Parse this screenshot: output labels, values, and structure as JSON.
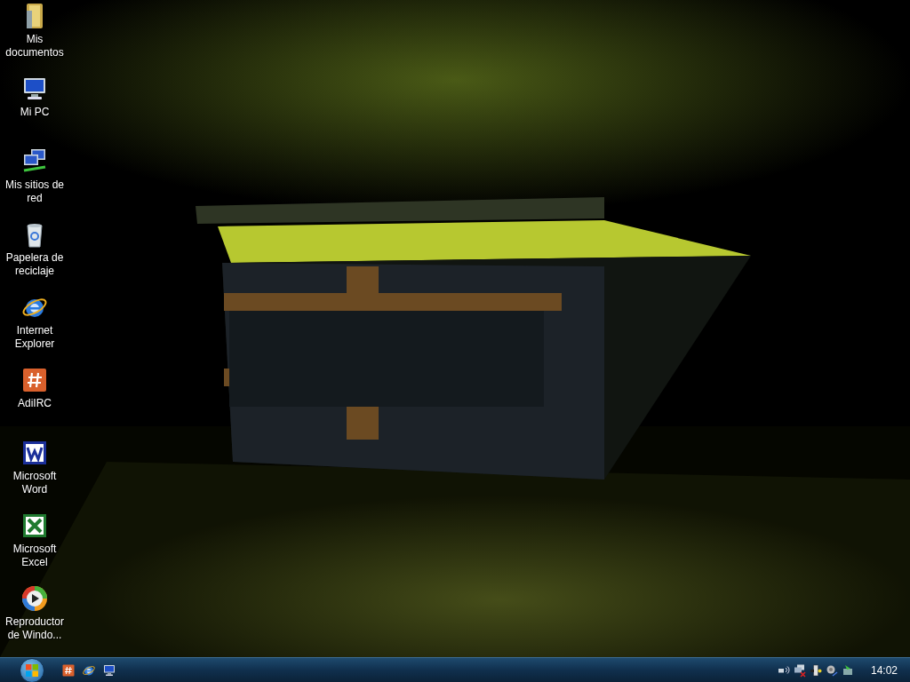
{
  "desktop": {
    "icons": [
      {
        "label": "Mis documentos",
        "kind": "folder"
      },
      {
        "label": "Mi PC",
        "kind": "computer"
      },
      {
        "label": "Mis sitios de red",
        "kind": "network"
      },
      {
        "label": "Papelera de reciclaje",
        "kind": "recycle"
      },
      {
        "label": "Internet Explorer",
        "kind": "browser"
      },
      {
        "label": "AdiIRC",
        "kind": "chat"
      },
      {
        "label": "Microsoft Word",
        "kind": "word"
      },
      {
        "label": "Microsoft Excel",
        "kind": "excel"
      },
      {
        "label": "Reproductor de Windo...",
        "kind": "player"
      }
    ]
  },
  "taskbar": {
    "quick_launch": [
      {
        "kind": "chat"
      },
      {
        "kind": "browser"
      },
      {
        "kind": "desktop"
      }
    ],
    "tray": [
      {
        "kind": "wireless"
      },
      {
        "kind": "network-error"
      },
      {
        "kind": "usb"
      },
      {
        "kind": "volume"
      },
      {
        "kind": "update"
      }
    ],
    "clock": "14:02"
  }
}
